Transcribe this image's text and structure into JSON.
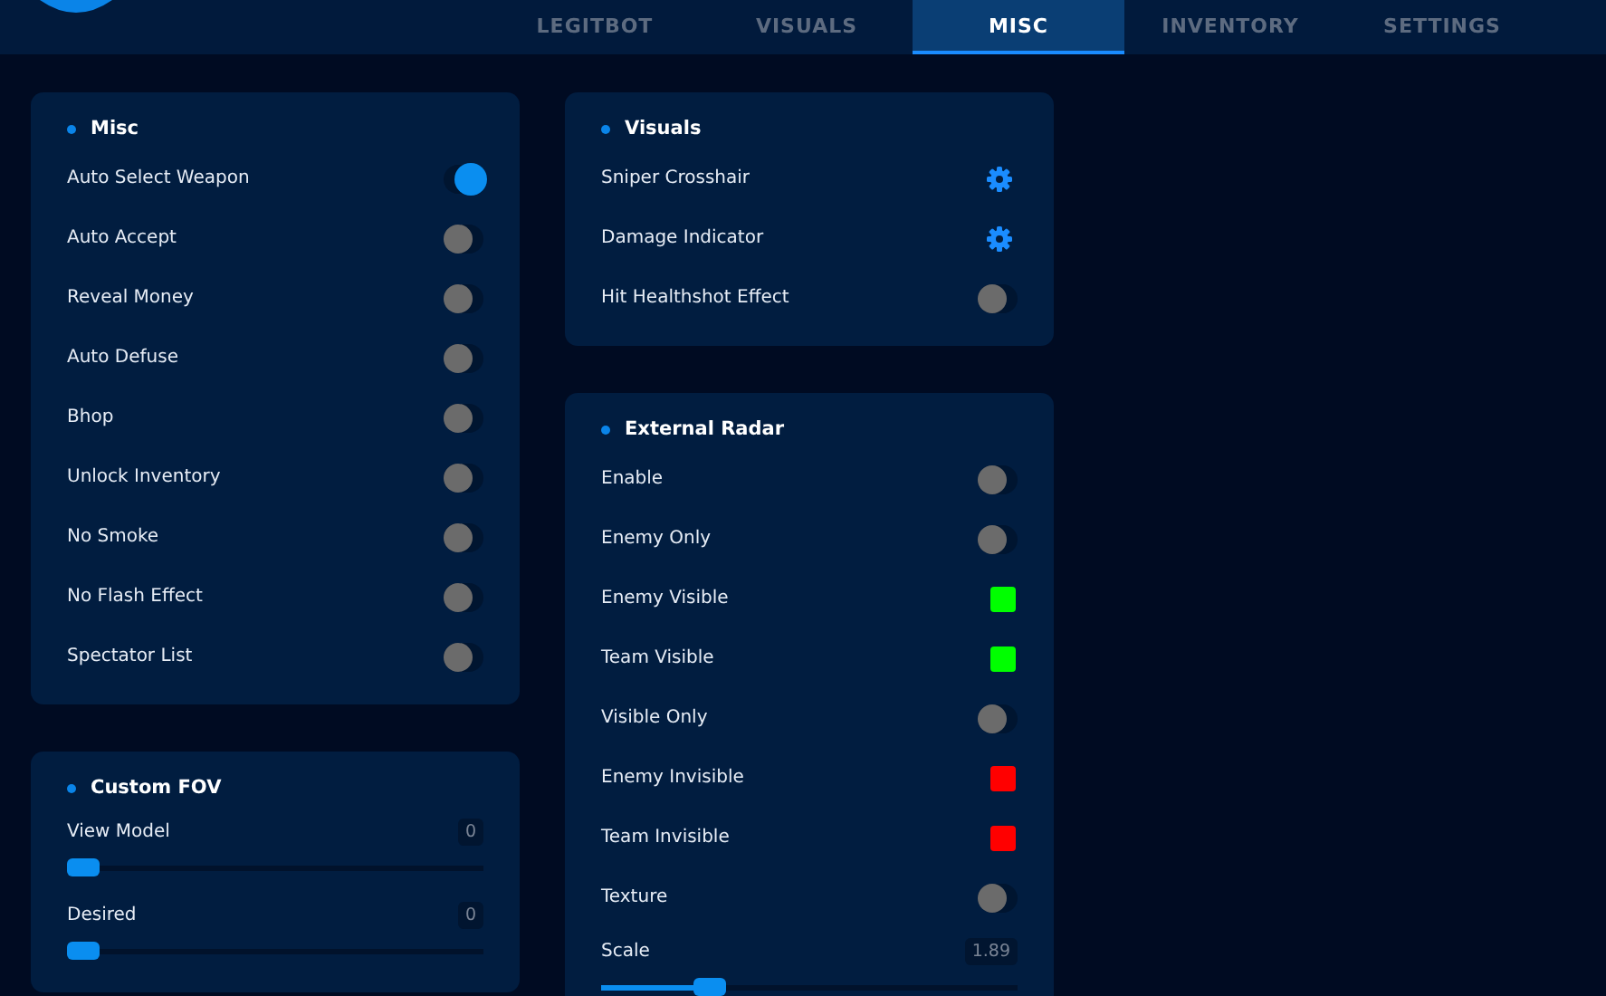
{
  "tabs": [
    {
      "label": "LEGITBOT",
      "selected": false
    },
    {
      "label": "VISUALS",
      "selected": false
    },
    {
      "label": "MISC",
      "selected": true
    },
    {
      "label": "INVENTORY",
      "selected": false
    },
    {
      "label": "SETTINGS",
      "selected": false
    }
  ],
  "columns": [
    {
      "panels": [
        {
          "title": "Misc",
          "rows": [
            {
              "kind": "toggle",
              "label": "Auto Select Weapon",
              "on": true
            },
            {
              "kind": "toggle",
              "label": "Auto Accept",
              "on": false
            },
            {
              "kind": "toggle",
              "label": "Reveal Money",
              "on": false
            },
            {
              "kind": "toggle",
              "label": "Auto Defuse",
              "on": false
            },
            {
              "kind": "toggle",
              "label": "Bhop",
              "on": false
            },
            {
              "kind": "toggle",
              "label": "Unlock Inventory",
              "on": false
            },
            {
              "kind": "toggle",
              "label": "No Smoke",
              "on": false
            },
            {
              "kind": "toggle",
              "label": "No Flash Effect",
              "on": false
            },
            {
              "kind": "toggle",
              "label": "Spectator List",
              "on": false
            }
          ]
        },
        {
          "title": "Custom FOV",
          "rows": [
            {
              "kind": "slider",
              "label": "View Model",
              "value": "0",
              "level": 0
            },
            {
              "kind": "slider",
              "label": "Desired",
              "value": "0",
              "level": 0
            }
          ]
        }
      ]
    },
    {
      "panels": [
        {
          "title": "Visuals",
          "rows": [
            {
              "kind": "gear",
              "label": "Sniper Crosshair"
            },
            {
              "kind": "gear",
              "label": "Damage Indicator"
            },
            {
              "kind": "toggle",
              "label": "Hit Healthshot Effect",
              "on": false
            }
          ]
        },
        {
          "title": "External Radar",
          "rows": [
            {
              "kind": "toggle",
              "label": "Enable",
              "on": false
            },
            {
              "kind": "toggle",
              "label": "Enemy Only",
              "on": false
            },
            {
              "kind": "color",
              "label": "Enemy Visible",
              "color": "#00ff00"
            },
            {
              "kind": "color",
              "label": "Team Visible",
              "color": "#00ff00"
            },
            {
              "kind": "toggle",
              "label": "Visible Only",
              "on": false
            },
            {
              "kind": "color",
              "label": "Enemy Invisible",
              "color": "#ff0000"
            },
            {
              "kind": "color",
              "label": "Team Invisible",
              "color": "#ff0000"
            },
            {
              "kind": "toggle",
              "label": "Texture",
              "on": false
            },
            {
              "kind": "slider",
              "label": "Scale",
              "value": "1.89",
              "level": 0.24
            }
          ]
        }
      ]
    }
  ]
}
